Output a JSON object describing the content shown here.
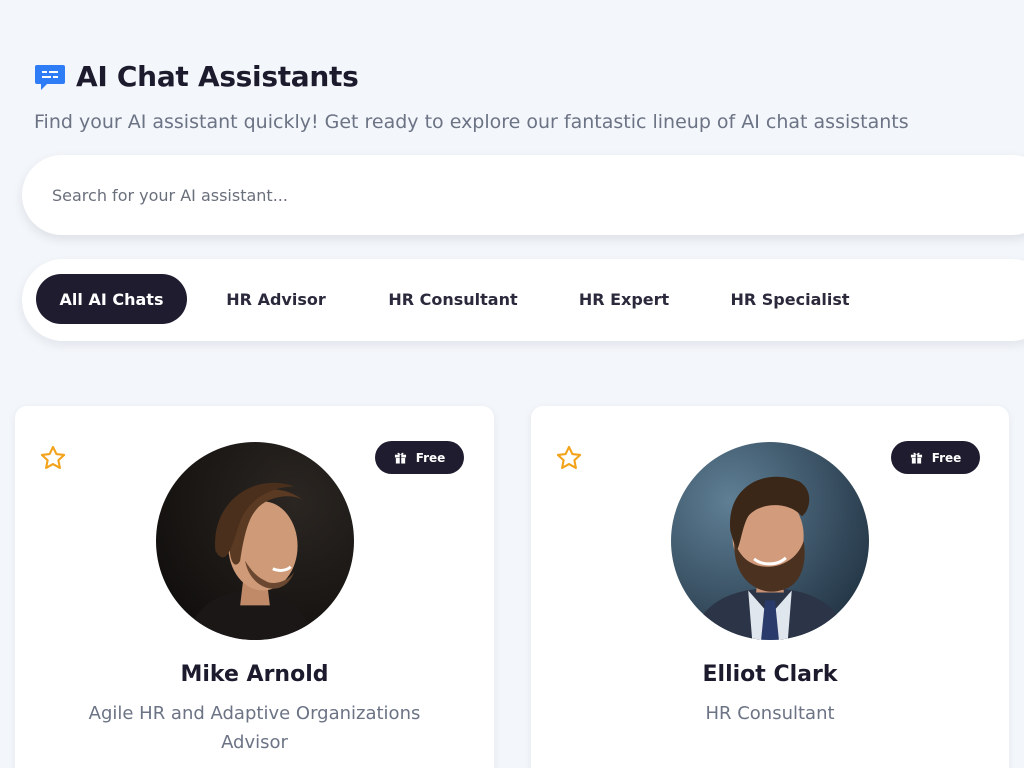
{
  "header": {
    "icon": "chat-bubble-icon",
    "title": "AI Chat Assistants",
    "subtitle": "Find your AI assistant quickly! Get ready to explore our fantastic lineup of AI chat assistants"
  },
  "search": {
    "placeholder": "Search for your AI assistant...",
    "value": ""
  },
  "filters": [
    {
      "label": "All AI Chats",
      "active": true
    },
    {
      "label": "HR Advisor",
      "active": false
    },
    {
      "label": "HR Consultant",
      "active": false
    },
    {
      "label": "HR Expert",
      "active": false
    },
    {
      "label": "HR Specialist",
      "active": false
    }
  ],
  "assistants": [
    {
      "name": "Mike Arnold",
      "role": "Agile HR and Adaptive Organizations Advisor",
      "badge": "Free",
      "favorite_icon": "star-outline-icon"
    },
    {
      "name": "Elliot Clark",
      "role": "HR Consultant",
      "badge": "Free",
      "favorite_icon": "star-outline-icon"
    }
  ],
  "colors": {
    "accent": "#1e1c2e",
    "brand_blue": "#2f7df6",
    "star": "#f2a31b",
    "background": "#f3f6fa"
  }
}
